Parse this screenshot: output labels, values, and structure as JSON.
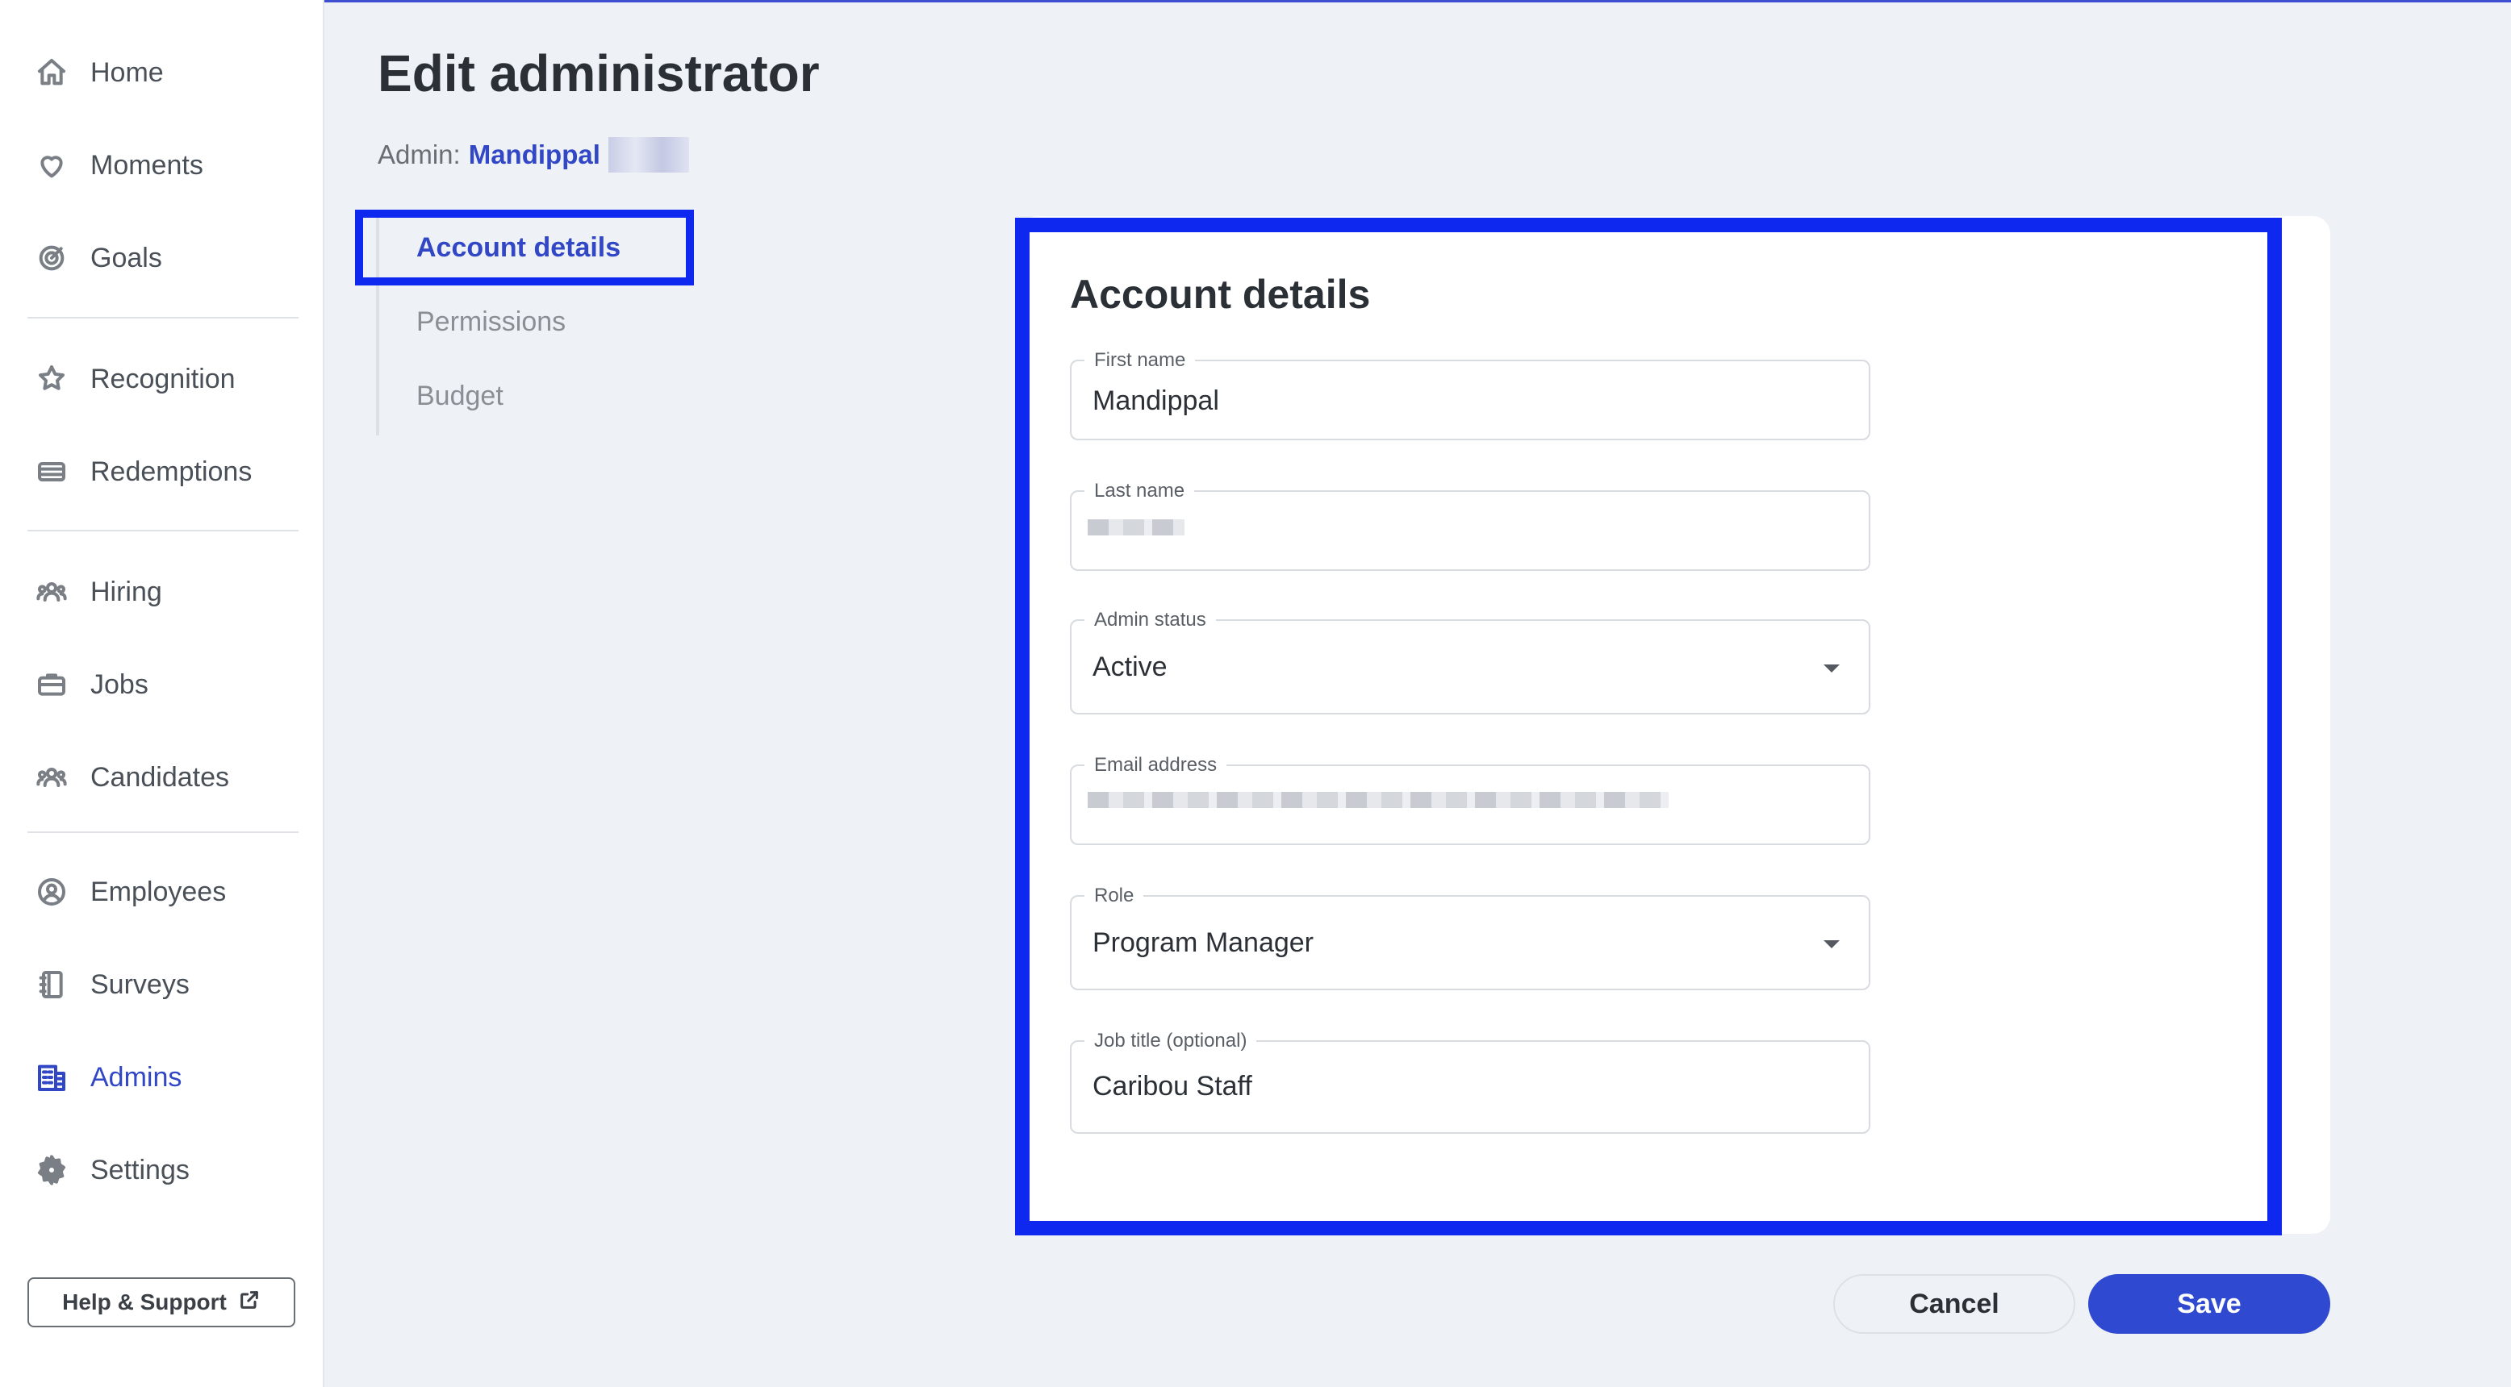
{
  "sidebar": {
    "items": [
      {
        "label": "Home",
        "icon": "home-icon"
      },
      {
        "label": "Moments",
        "icon": "heart-icon"
      },
      {
        "label": "Goals",
        "icon": "target-icon"
      },
      {
        "label": "Recognition",
        "icon": "star-badge-icon"
      },
      {
        "label": "Redemptions",
        "icon": "card-icon"
      },
      {
        "label": "Hiring",
        "icon": "people-icon"
      },
      {
        "label": "Jobs",
        "icon": "briefcase-icon"
      },
      {
        "label": "Candidates",
        "icon": "people-icon"
      },
      {
        "label": "Employees",
        "icon": "user-circle-icon"
      },
      {
        "label": "Surveys",
        "icon": "notebook-icon"
      },
      {
        "label": "Admins",
        "icon": "building-icon",
        "active": true
      },
      {
        "label": "Settings",
        "icon": "gear-icon"
      }
    ],
    "help_label": "Help & Support"
  },
  "header": {
    "title": "Edit administrator",
    "admin_prefix": "Admin:",
    "admin_name": "Mandippal"
  },
  "sections": [
    {
      "label": "Account details",
      "active": true
    },
    {
      "label": "Permissions"
    },
    {
      "label": "Budget"
    }
  ],
  "form": {
    "title": "Account details",
    "first_name": {
      "label": "First name",
      "value": "Mandippal"
    },
    "last_name": {
      "label": "Last name",
      "value": ""
    },
    "admin_status": {
      "label": "Admin status",
      "value": "Active"
    },
    "email": {
      "label": "Email address",
      "value": ""
    },
    "role": {
      "label": "Role",
      "value": "Program Manager"
    },
    "job_title": {
      "label": "Job title (optional)",
      "value": "Caribou Staff"
    }
  },
  "actions": {
    "cancel": "Cancel",
    "save": "Save"
  },
  "colors": {
    "accent": "#3147c5",
    "highlight": "#0f28f0",
    "background": "#eef2f6"
  }
}
